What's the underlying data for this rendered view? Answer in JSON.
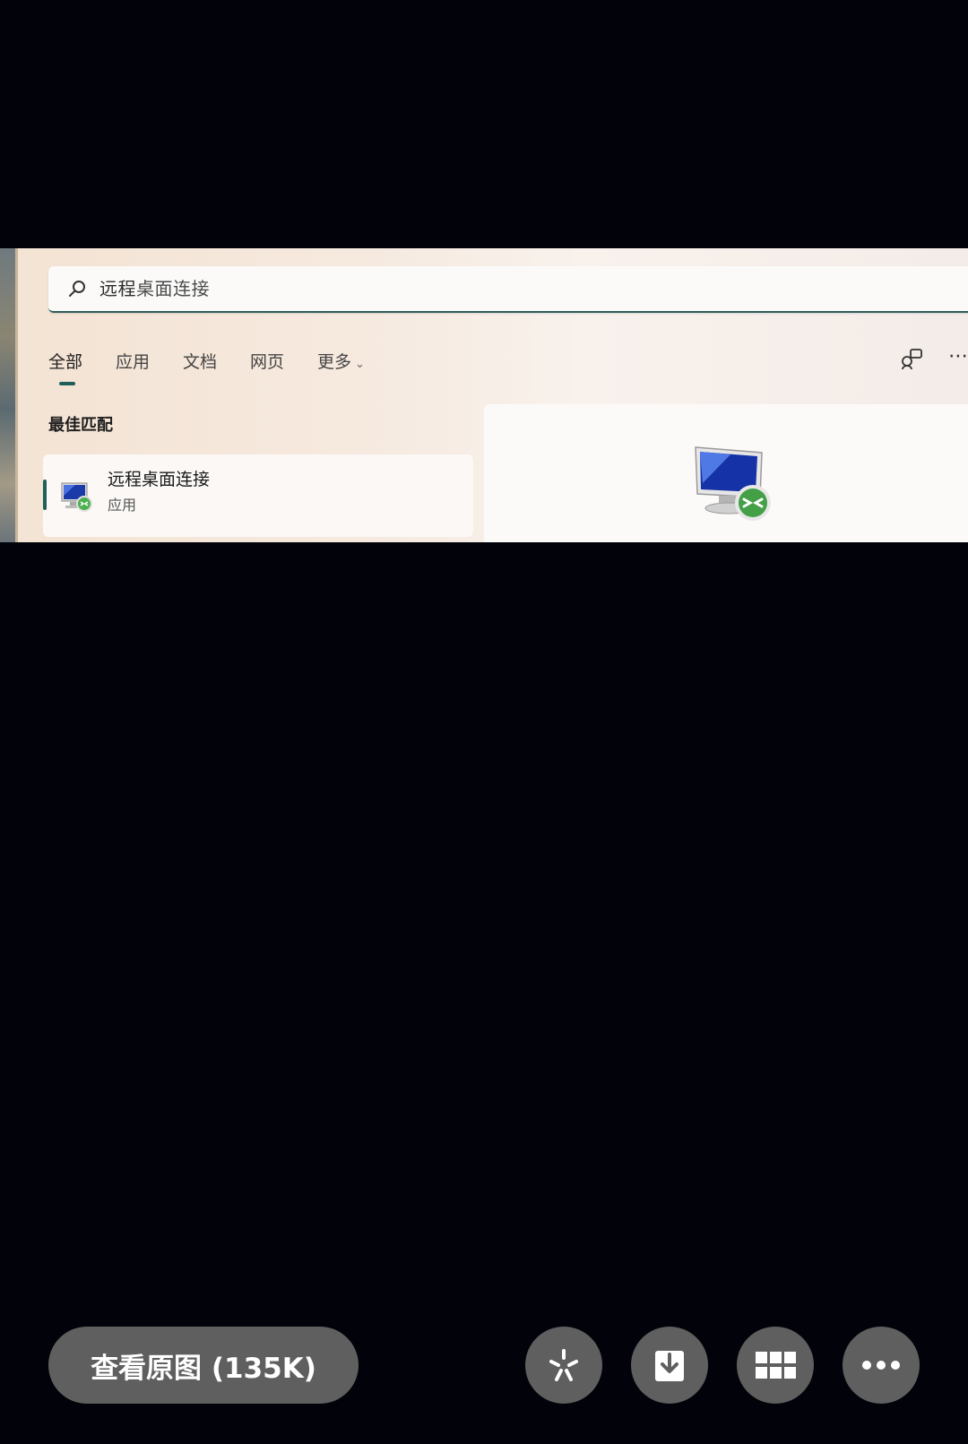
{
  "search": {
    "query_typed": "远程",
    "query_rest": "桌面连接"
  },
  "tabs": [
    {
      "label": "全部",
      "active": true
    },
    {
      "label": "应用",
      "active": false
    },
    {
      "label": "文档",
      "active": false
    },
    {
      "label": "网页",
      "active": false
    },
    {
      "label": "更多",
      "active": false
    }
  ],
  "best_match": {
    "section_label": "最佳匹配",
    "title": "远程桌面连接",
    "subtitle": "应用",
    "icon": "remote-desktop-icon"
  },
  "viewer": {
    "view_original_label": "查看原图 (135K)",
    "actions": [
      {
        "icon": "edit-icon"
      },
      {
        "icon": "download-icon"
      },
      {
        "icon": "grid-icon"
      },
      {
        "icon": "more-icon"
      }
    ]
  },
  "colors": {
    "accent": "#1f5e59",
    "viewer_button": "#5f5f5f",
    "background": "#02030a"
  }
}
